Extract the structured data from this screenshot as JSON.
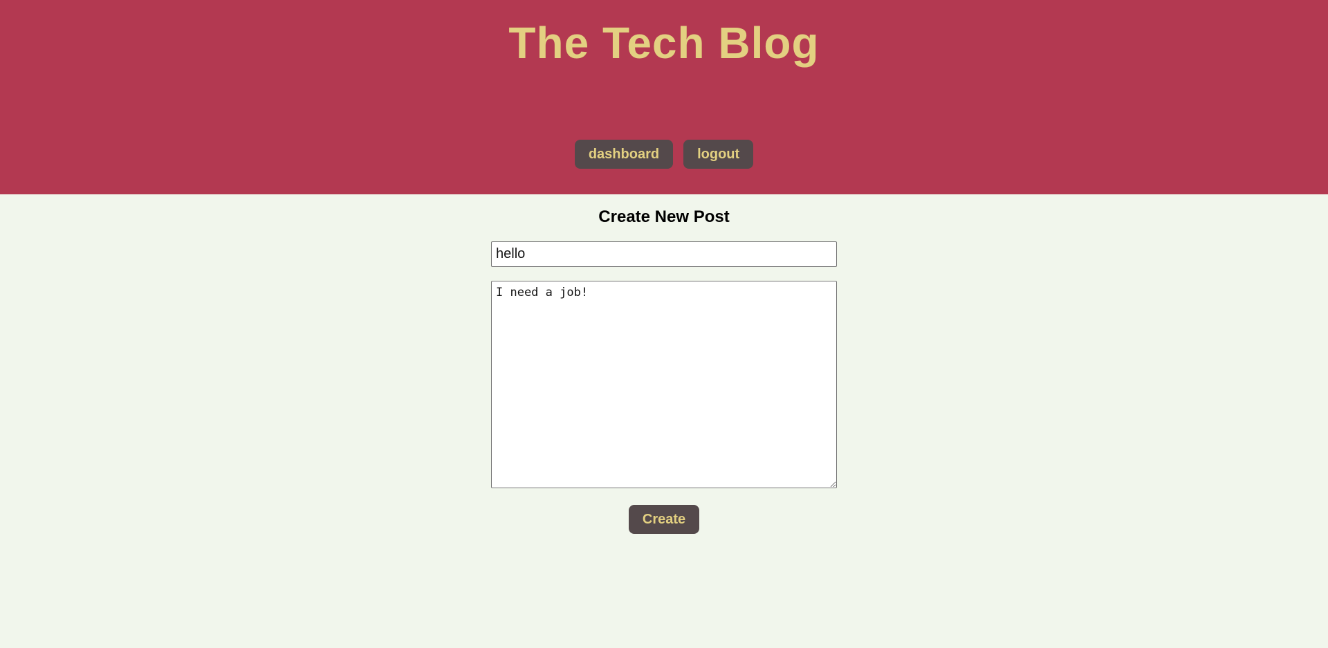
{
  "header": {
    "title": "The Tech Blog",
    "nav": [
      {
        "label": "dashboard"
      },
      {
        "label": "logout"
      }
    ]
  },
  "form": {
    "heading": "Create New Post",
    "title_value": "hello",
    "content_value": "I need a job!",
    "submit_label": "Create"
  },
  "colors": {
    "header_bg": "#b33951",
    "accent_text": "#e3d081",
    "button_bg": "#54494b",
    "page_bg": "#f1f6ec"
  }
}
